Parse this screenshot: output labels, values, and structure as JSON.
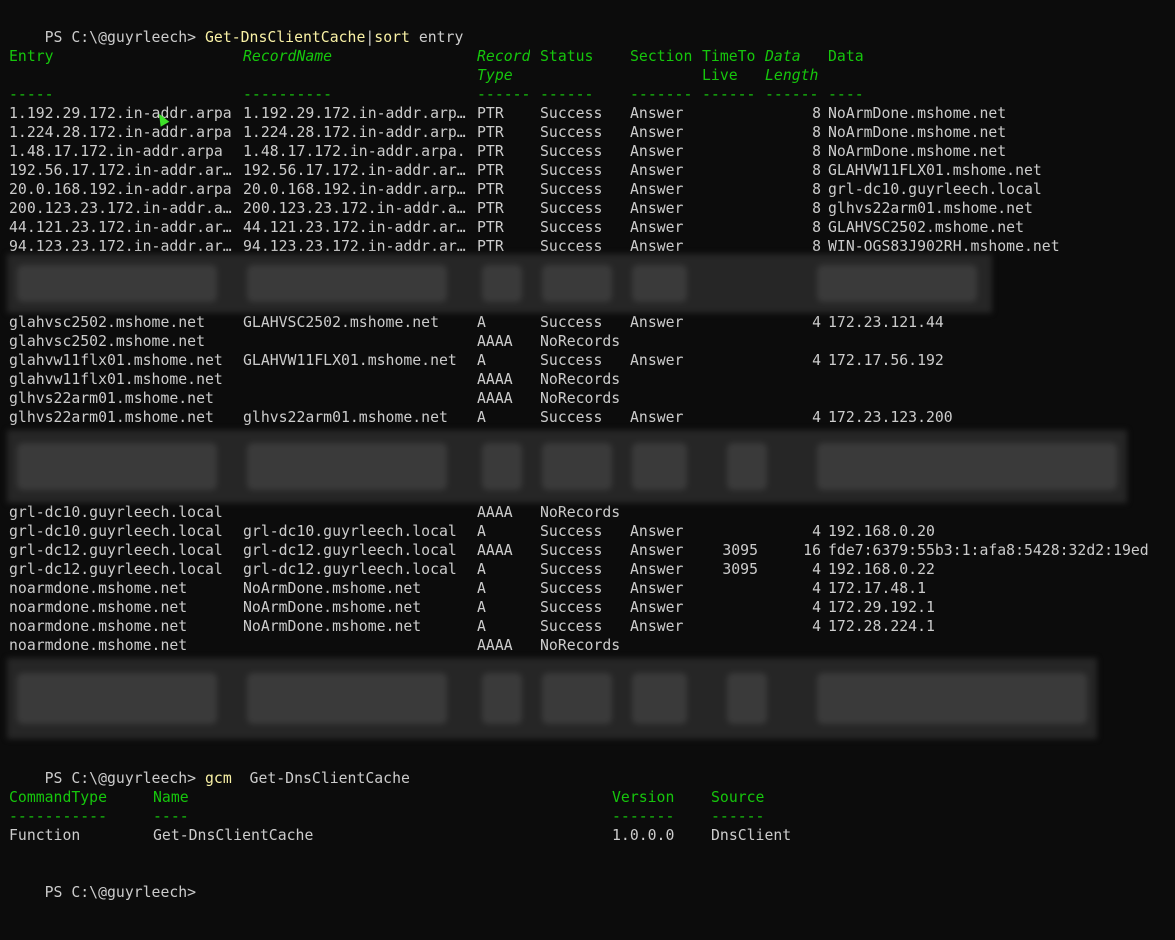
{
  "window": {
    "prompt": "PS C:\\@guyrleech> ",
    "first_command": {
      "cmdlet": "Get-DnsClientCache",
      "pipe": "|",
      "sort": "sort",
      "args": " entry"
    },
    "second_command": {
      "gcm": "gcm",
      "args": "  Get-DnsClientCache"
    }
  },
  "dns_table": {
    "headers": {
      "entry": "Entry",
      "recordname": "RecordName",
      "record_type_1": "Record",
      "record_type_2": "Type",
      "status": "Status",
      "section": "Section",
      "ttl_1": "TimeTo",
      "ttl_2": "Live",
      "dl_1": "Data",
      "dl_2": "Length",
      "data": "Data"
    },
    "separators": {
      "entry": "-----",
      "recordname": "----------",
      "type": "------",
      "status": "------",
      "section": "-------",
      "ttl": "------",
      "dl": "------",
      "data": "----"
    },
    "rows": [
      {
        "entry": "1.192.29.172.in-addr.arpa",
        "recordname": "1.192.29.172.in-addr.arp…",
        "type": "PTR",
        "status": "Success",
        "section": "Answer",
        "ttl": "",
        "dl": "8",
        "data": "NoArmDone.mshome.net"
      },
      {
        "entry": "1.224.28.172.in-addr.arpa",
        "recordname": "1.224.28.172.in-addr.arp…",
        "type": "PTR",
        "status": "Success",
        "section": "Answer",
        "ttl": "",
        "dl": "8",
        "data": "NoArmDone.mshome.net"
      },
      {
        "entry": "1.48.17.172.in-addr.arpa",
        "recordname": "1.48.17.172.in-addr.arpa.",
        "type": "PTR",
        "status": "Success",
        "section": "Answer",
        "ttl": "",
        "dl": "8",
        "data": "NoArmDone.mshome.net"
      },
      {
        "entry": "192.56.17.172.in-addr.ar…",
        "recordname": "192.56.17.172.in-addr.ar…",
        "type": "PTR",
        "status": "Success",
        "section": "Answer",
        "ttl": "",
        "dl": "8",
        "data": "GLAHVW11FLX01.mshome.net"
      },
      {
        "entry": "20.0.168.192.in-addr.arpa",
        "recordname": "20.0.168.192.in-addr.arp…",
        "type": "PTR",
        "status": "Success",
        "section": "Answer",
        "ttl": "",
        "dl": "8",
        "data": "grl-dc10.guyrleech.local"
      },
      {
        "entry": "200.123.23.172.in-addr.a…",
        "recordname": "200.123.23.172.in-addr.a…",
        "type": "PTR",
        "status": "Success",
        "section": "Answer",
        "ttl": "",
        "dl": "8",
        "data": "glhvs22arm01.mshome.net"
      },
      {
        "entry": "44.121.23.172.in-addr.ar…",
        "recordname": "44.121.23.172.in-addr.ar…",
        "type": "PTR",
        "status": "Success",
        "section": "Answer",
        "ttl": "",
        "dl": "8",
        "data": "GLAHVSC2502.mshome.net"
      },
      {
        "entry": "94.123.23.172.in-addr.ar…",
        "recordname": "94.123.23.172.in-addr.ar…",
        "type": "PTR",
        "status": "Success",
        "section": "Answer",
        "ttl": "",
        "dl": "8",
        "data": "WIN-OGS83J902RH.mshome.net"
      },
      {
        "entry": "glahvsc2502.mshome.net",
        "recordname": "GLAHVSC2502.mshome.net",
        "type": "A",
        "status": "Success",
        "section": "Answer",
        "ttl": "",
        "dl": "4",
        "data": "172.23.121.44"
      },
      {
        "entry": "glahvsc2502.mshome.net",
        "recordname": "",
        "type": "AAAA",
        "status": "NoRecords",
        "section": "",
        "ttl": "",
        "dl": "",
        "data": ""
      },
      {
        "entry": "glahvw11flx01.mshome.net",
        "recordname": "GLAHVW11FLX01.mshome.net",
        "type": "A",
        "status": "Success",
        "section": "Answer",
        "ttl": "",
        "dl": "4",
        "data": "172.17.56.192"
      },
      {
        "entry": "glahvw11flx01.mshome.net",
        "recordname": "",
        "type": "AAAA",
        "status": "NoRecords",
        "section": "",
        "ttl": "",
        "dl": "",
        "data": ""
      },
      {
        "entry": "glhvs22arm01.mshome.net",
        "recordname": "",
        "type": "AAAA",
        "status": "NoRecords",
        "section": "",
        "ttl": "",
        "dl": "",
        "data": ""
      },
      {
        "entry": "glhvs22arm01.mshome.net",
        "recordname": "glhvs22arm01.mshome.net",
        "type": "A",
        "status": "Success",
        "section": "Answer",
        "ttl": "",
        "dl": "4",
        "data": "172.23.123.200"
      },
      {
        "entry": "grl-dc10.guyrleech.local",
        "recordname": "",
        "type": "AAAA",
        "status": "NoRecords",
        "section": "",
        "ttl": "",
        "dl": "",
        "data": ""
      },
      {
        "entry": "grl-dc10.guyrleech.local",
        "recordname": "grl-dc10.guyrleech.local",
        "type": "A",
        "status": "Success",
        "section": "Answer",
        "ttl": "",
        "dl": "4",
        "data": "192.168.0.20"
      },
      {
        "entry": "grl-dc12.guyrleech.local",
        "recordname": "grl-dc12.guyrleech.local",
        "type": "AAAA",
        "status": "Success",
        "section": "Answer",
        "ttl": "3095",
        "dl": "16",
        "data": "fde7:6379:55b3:1:afa8:5428:32d2:19ed"
      },
      {
        "entry": "grl-dc12.guyrleech.local",
        "recordname": "grl-dc12.guyrleech.local",
        "type": "A",
        "status": "Success",
        "section": "Answer",
        "ttl": "3095",
        "dl": "4",
        "data": "192.168.0.22"
      },
      {
        "entry": "noarmdone.mshome.net",
        "recordname": "NoArmDone.mshome.net",
        "type": "A",
        "status": "Success",
        "section": "Answer",
        "ttl": "",
        "dl": "4",
        "data": "172.17.48.1"
      },
      {
        "entry": "noarmdone.mshome.net",
        "recordname": "NoArmDone.mshome.net",
        "type": "A",
        "status": "Success",
        "section": "Answer",
        "ttl": "",
        "dl": "4",
        "data": "172.29.192.1"
      },
      {
        "entry": "noarmdone.mshome.net",
        "recordname": "NoArmDone.mshome.net",
        "type": "A",
        "status": "Success",
        "section": "Answer",
        "ttl": "",
        "dl": "4",
        "data": "172.28.224.1"
      },
      {
        "entry": "noarmdone.mshome.net",
        "recordname": "",
        "type": "AAAA",
        "status": "NoRecords",
        "section": "",
        "ttl": "",
        "dl": "",
        "data": ""
      }
    ]
  },
  "gcm_table": {
    "headers": {
      "commandtype": "CommandType",
      "name": "Name",
      "version": "Version",
      "source": "Source"
    },
    "separators": {
      "commandtype": "-----------",
      "name": "----",
      "version": "-------",
      "source": "------"
    },
    "row": {
      "commandtype": "Function",
      "name": "Get-DnsClientCache",
      "version": "1.0.0.0",
      "source": "DnsClient"
    }
  },
  "colors": {
    "background": "#0c0c0c",
    "foreground": "#cccccc",
    "header": "#16c60c",
    "command": "#f9f1a5"
  }
}
